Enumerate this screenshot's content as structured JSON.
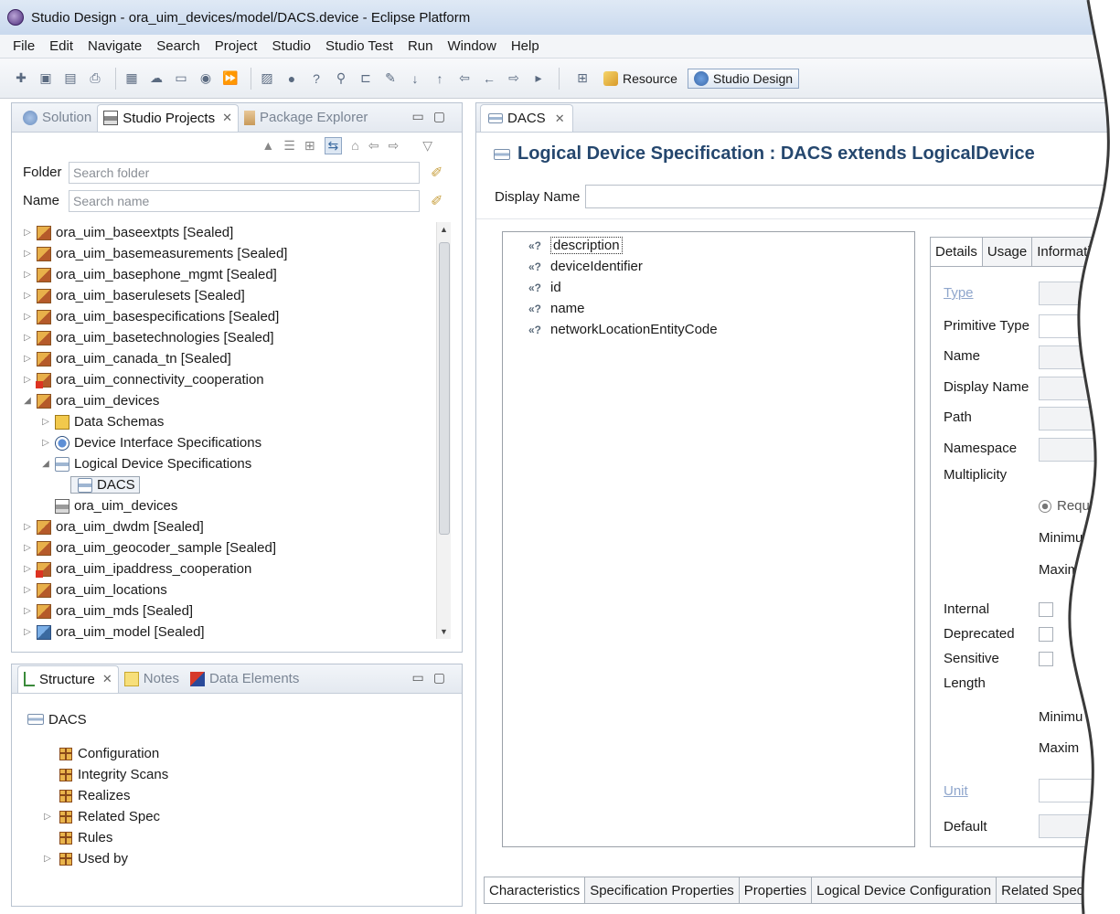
{
  "window": {
    "title": "Studio Design - ora_uim_devices/model/DACS.device - Eclipse Platform"
  },
  "menu": [
    "File",
    "Edit",
    "Navigate",
    "Search",
    "Project",
    "Studio",
    "Studio Test",
    "Run",
    "Window",
    "Help"
  ],
  "perspectives": {
    "resource": "Resource",
    "studio_design": "Studio Design"
  },
  "left_panel": {
    "tabs": {
      "solution": "Solution",
      "studio_projects": "Studio Projects",
      "package_explorer": "Package Explorer"
    },
    "folder_label": "Folder",
    "folder_placeholder": "Search folder",
    "name_label": "Name",
    "name_placeholder": "Search name",
    "tree": [
      "ora_uim_baseextpts [Sealed]",
      "ora_uim_basemeasurements [Sealed]",
      "ora_uim_basephone_mgmt [Sealed]",
      "ora_uim_baserulesets [Sealed]",
      "ora_uim_basespecifications [Sealed]",
      "ora_uim_basetechnologies [Sealed]",
      "ora_uim_canada_tn [Sealed]",
      "ora_uim_connectivity_cooperation",
      "ora_uim_devices",
      "Data Schemas",
      "Device Interface Specifications",
      "Logical Device Specifications",
      "DACS",
      "ora_uim_devices",
      "ora_uim_dwdm [Sealed]",
      "ora_uim_geocoder_sample [Sealed]",
      "ora_uim_ipaddress_cooperation",
      "ora_uim_locations",
      "ora_uim_mds [Sealed]",
      "ora_uim_model [Sealed]"
    ]
  },
  "structure_panel": {
    "tabs": {
      "structure": "Structure",
      "notes": "Notes",
      "data_elements": "Data Elements"
    },
    "root": "DACS",
    "items": [
      "Configuration",
      "Integrity Scans",
      "Realizes",
      "Related Spec",
      "Rules",
      "Used by"
    ]
  },
  "editor": {
    "tab": "DACS",
    "header": "Logical Device Specification : DACS extends LogicalDevice",
    "display_name_label": "Display Name",
    "display_name_value": "",
    "characteristics": [
      "description",
      "deviceIdentifier",
      "id",
      "name",
      "networkLocationEntityCode"
    ],
    "details_tabs": [
      "Details",
      "Usage",
      "Informati"
    ],
    "details": {
      "type": "Type",
      "primitive_type": "Primitive Type",
      "name": "Name",
      "display_name": "Display Name",
      "path": "Path",
      "namespace": "Namespace",
      "multiplicity": "Multiplicity",
      "required": "Require",
      "minimum": "Minimum",
      "maximum": "Maximum",
      "internal": "Internal",
      "deprecated": "Deprecated",
      "sensitive": "Sensitive",
      "length": "Length",
      "length_min": "Minimu",
      "length_max": "Maxim",
      "unit": "Unit",
      "default": "Default"
    },
    "bottom_tabs": [
      "Characteristics",
      "Specification Properties",
      "Properties",
      "Logical Device Configuration",
      "Related Specifi"
    ]
  }
}
